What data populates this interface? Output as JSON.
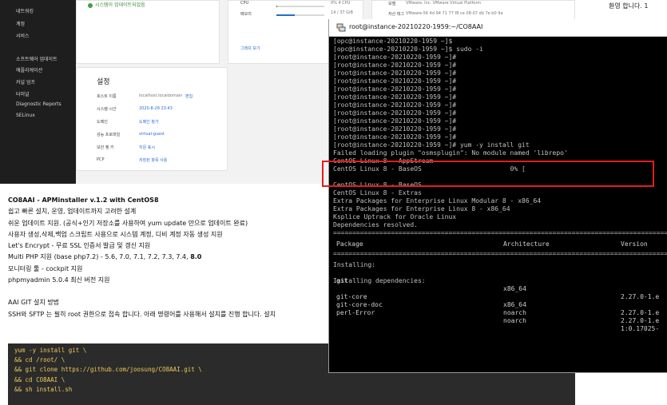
{
  "sidebar": {
    "items_top": [
      "네트워킹",
      "계정",
      "서비스"
    ],
    "items_bottom": [
      "소프트웨어 업데이트",
      "애플리케이션",
      "커널 덤프",
      "터미널",
      "Diagnostic Reports",
      "SELinux"
    ]
  },
  "cockpit": {
    "status_text": "시스템이 업데이트되었음",
    "usage": [
      {
        "label": "CPU",
        "value": "0% 4 CPU",
        "fraction": 0.02
      },
      {
        "label": "메모리",
        "value": "14 / 37 GiB",
        "fraction": 0.38
      }
    ],
    "system_info": [
      {
        "label": "모델",
        "value": "VMware, Inc. VMware Virtual Platform"
      },
      {
        "label": "자산 태그",
        "value": "VMware-56 4d 94 71 77 f8 ce 08-07 db 7e b0 9a"
      }
    ],
    "graph_link": "그래프 보기",
    "settings": {
      "title": "설정",
      "rows": [
        {
          "label": "호스트 이름",
          "value": "localhost.localdomain",
          "action": "편집"
        },
        {
          "label": "시스템 시간",
          "value": "2020-8-28 23:43",
          "action": ""
        },
        {
          "label": "도메인",
          "value": "도메인 참가",
          "action": ""
        },
        {
          "label": "성능 프로파일",
          "value": "virtual-guest",
          "action": ""
        },
        {
          "label": "보안 쉘 키",
          "value": "지문 표시",
          "action": ""
        },
        {
          "label": "PCP",
          "value": "저장된 항목 사용",
          "action": ""
        }
      ]
    }
  },
  "welcome": "환영 합니다. 1",
  "article": {
    "title": "CO8AAI - APMinstaller v.1.2 with CentOS8",
    "lines": [
      "쉽고 빠른 설치, 운영, 업데이트까지 고려한 설계",
      "쉬운 업데이트 지원. (공식+인기 저장소를 사용하여 yum update 만으로 업데이트 완료)",
      "사용자 생성,삭제,백업 스크립트 사용으로 시스템 계정, 디비 계정 자동 생성 지원",
      "Let's Encrypt - 무료 SSL 인증서 발급 및 갱신 지원"
    ],
    "php_line": "Multi PHP 지원 (base php7.2) - 5.6, 7.0, 7.1, 7.2, 7.3, 7.4, ",
    "php_bold": "8.0",
    "lines2": [
      "모니터링 툴 - cockpit 지원",
      "phpmyadmin 5.0.4 최신 버전 지원"
    ],
    "git_heading": "AAI GIT 설치 방법",
    "git_desc": "SSH와 SFTP 는 필히 root 권한으로 접속 합니다. 아래 명령어를 사용해서 설치를 진행 합니다. 설치"
  },
  "code": [
    "yum -y install git \\",
    "&& cd /root/ \\",
    "&& git clone https://github.com/joosung/CO8AAI.git \\",
    "&& cd CO8AAI \\",
    "&& sh install.sh"
  ],
  "terminal": {
    "title": "root@instance-20210220-1959:~/CO8AAI",
    "lines": [
      "[opc@instance-20210220-1959 ~]$",
      "[opc@instance-20210220-1959 ~]$ sudo -i",
      "[root@instance-20210220-1959 ~]#",
      "[root@instance-20210220-1959 ~]#",
      "[root@instance-20210220-1959 ~]#",
      "[root@instance-20210220-1959 ~]#",
      "[root@instance-20210220-1959 ~]#",
      "[root@instance-20210220-1959 ~]#",
      "[root@instance-20210220-1959 ~]#",
      "[root@instance-20210220-1959 ~]#",
      "[root@instance-20210220-1959 ~]#",
      "[root@instance-20210220-1959 ~]#",
      "[root@instance-20210220-1959 ~]#",
      "[root@instance-20210220-1959 ~]# yum -y install git",
      "Failed loading plugin \"osmsplugin\": No module named 'librepo'",
      "CentOS Linux 8 - AppStream",
      "CentOS Linux 8 - BaseOS                       0% [",
      "",
      "CentOS Linux 8 - BaseOS",
      "CentOS Linux 8 - Extras",
      "Extra Packages for Enterprise Linux Modular 8 - x86_64",
      "Extra Packages for Enterprise Linux 8 - x86_64",
      "Ksplice Uptrack for Oracle Linux",
      "Dependencies resolved.",
      "=========================================================================================="
    ],
    "table_headers": [
      "Package",
      "Architecture",
      "Version"
    ],
    "installing_label": "Installing:",
    "installing_deps_label": "Installing dependencies:",
    "packages": [
      {
        "name": "git",
        "arch": "x86_64",
        "version": "2.27.0-1.e"
      }
    ],
    "dep_packages": [
      {
        "name": "git-core",
        "arch": "x86_64",
        "version": "2.27.0-1.e"
      },
      {
        "name": "git-core-doc",
        "arch": "noarch",
        "version": "2.27.0-1.e"
      },
      {
        "name": "perl-Error",
        "arch": "noarch",
        "version": "1:0.17025-"
      }
    ]
  }
}
